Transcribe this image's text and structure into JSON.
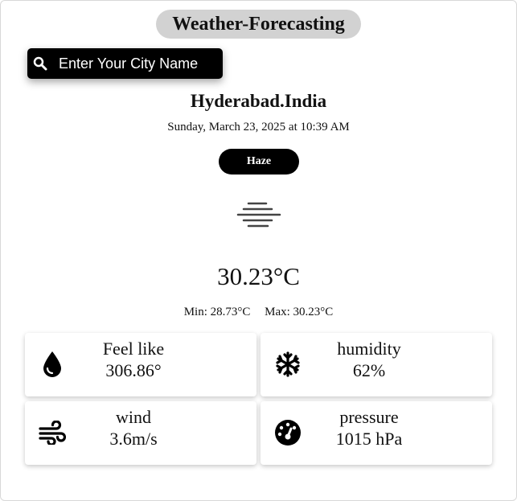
{
  "app": {
    "title": "Weather-Forecasting"
  },
  "search": {
    "placeholder": "Enter Your City Name",
    "value": "",
    "icon": "search-icon"
  },
  "location": {
    "city": "Hyderabad.India",
    "datetime": "Sunday, March 23, 2025 at 10:39 AM"
  },
  "weather": {
    "condition": "Haze",
    "icon": "haze-icon",
    "temperature": "30.23°C",
    "min": "Min: 28.73°C",
    "max": "Max: 30.23°C"
  },
  "details": {
    "feel": {
      "label": "Feel like",
      "value": "306.86°",
      "icon": "droplet-icon"
    },
    "humidity": {
      "label": "humidity",
      "value": "62%",
      "icon": "snowflake-icon"
    },
    "wind": {
      "label": "wind",
      "value": "3.6m/s",
      "icon": "wind-icon"
    },
    "pressure": {
      "label": "pressure",
      "value": "1015 hPa",
      "icon": "gauge-icon"
    }
  },
  "colors": {
    "title_pill": "#d2d2d2",
    "dark": "#000000",
    "text": "#111111"
  }
}
